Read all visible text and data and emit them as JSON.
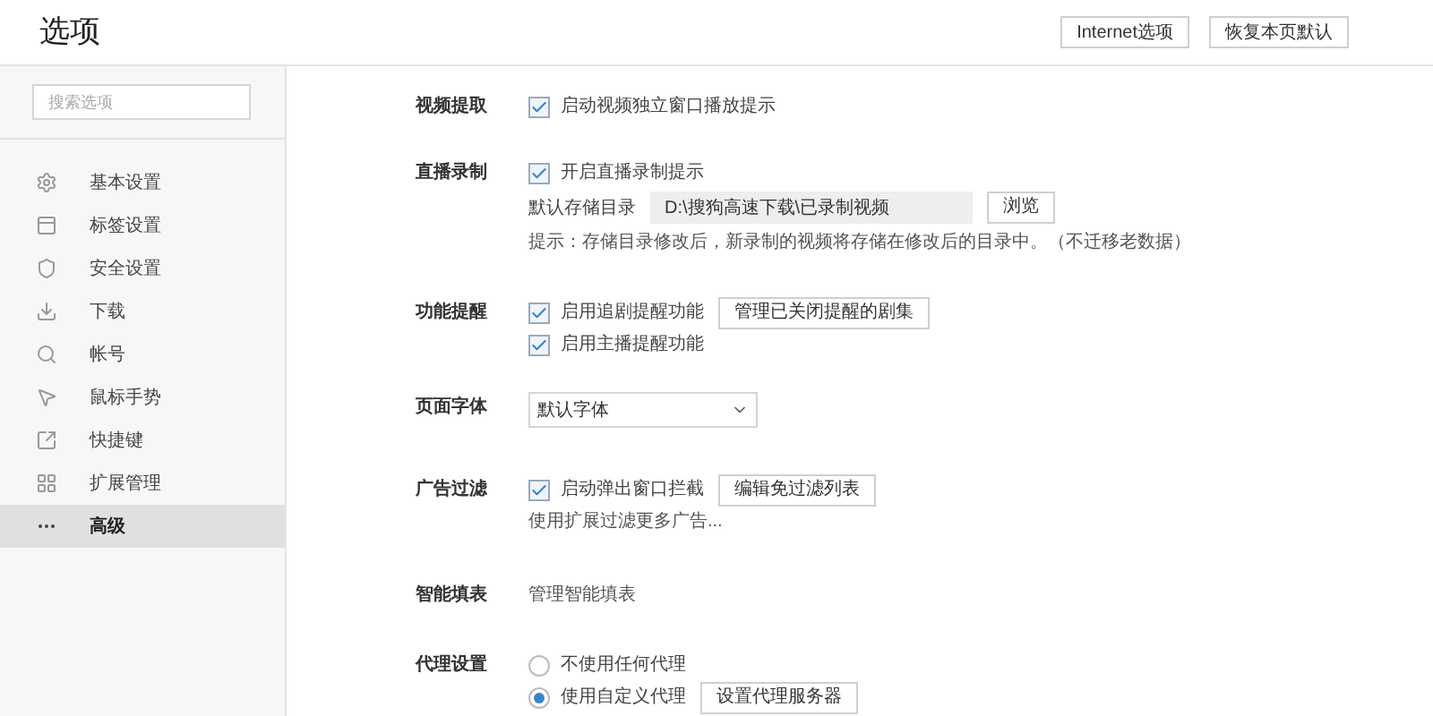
{
  "window": {
    "title": "选项"
  },
  "header_buttons": [
    "Internet选项",
    "恢复本页默认"
  ],
  "sidebar": {
    "search": {
      "placeholder": "搜索选项"
    },
    "items": [
      {
        "label": "基本设置",
        "selected": false
      },
      {
        "label": "标签设置",
        "selected": false
      },
      {
        "label": "安全设置",
        "selected": false
      },
      {
        "label": "下载",
        "selected": false
      },
      {
        "label": "帐号",
        "selected": false
      },
      {
        "label": "鼠标手势",
        "selected": false
      },
      {
        "label": "快捷键",
        "selected": false
      },
      {
        "label": "扩展管理",
        "selected": false
      },
      {
        "label": "高级",
        "selected": true
      }
    ]
  },
  "sections": [
    {
      "label": "视频提取",
      "rows": [
        {
          "kind": "checkbox",
          "label": "启动视频独立窗口播放提示",
          "checked": true
        }
      ]
    },
    {
      "label": "直播录制",
      "rows": [
        {
          "kind": "checkbox",
          "label": "开启直播录制提示",
          "checked": true
        },
        {
          "kind": "path",
          "label": "默认存储目录",
          "value": "D:\\搜狗高速下载\\已录制视频",
          "button": "浏览"
        },
        {
          "kind": "note",
          "text": "提示：存储目录修改后，新录制的视频将存储在修改后的目录中。（不迁移老数据）"
        }
      ]
    },
    {
      "label": "功能提醒",
      "rows": [
        {
          "kind": "checkbox",
          "label": "启用追剧提醒功能",
          "checked": true,
          "button": "管理已关闭提醒的剧集"
        },
        {
          "kind": "checkbox",
          "label": "启用主播提醒功能",
          "checked": true
        }
      ]
    },
    {
      "label": "页面字体",
      "rows": [
        {
          "kind": "select",
          "value": "默认字体"
        }
      ]
    },
    {
      "label": "广告过滤",
      "rows": [
        {
          "kind": "checkbox",
          "label": "启动弹出窗口拦截",
          "checked": true,
          "button": "编辑免过滤列表"
        },
        {
          "kind": "note",
          "text": "使用扩展过滤更多广告..."
        }
      ]
    },
    {
      "label": "智能填表",
      "rows": [
        {
          "kind": "note",
          "text": "管理智能填表"
        }
      ]
    },
    {
      "label": "代理设置",
      "rows": [
        {
          "kind": "radio",
          "label": "不使用任何代理",
          "selected": false
        },
        {
          "kind": "radio",
          "label": "使用自定义代理",
          "selected": true,
          "button": "设置代理服务器"
        }
      ]
    }
  ]
}
